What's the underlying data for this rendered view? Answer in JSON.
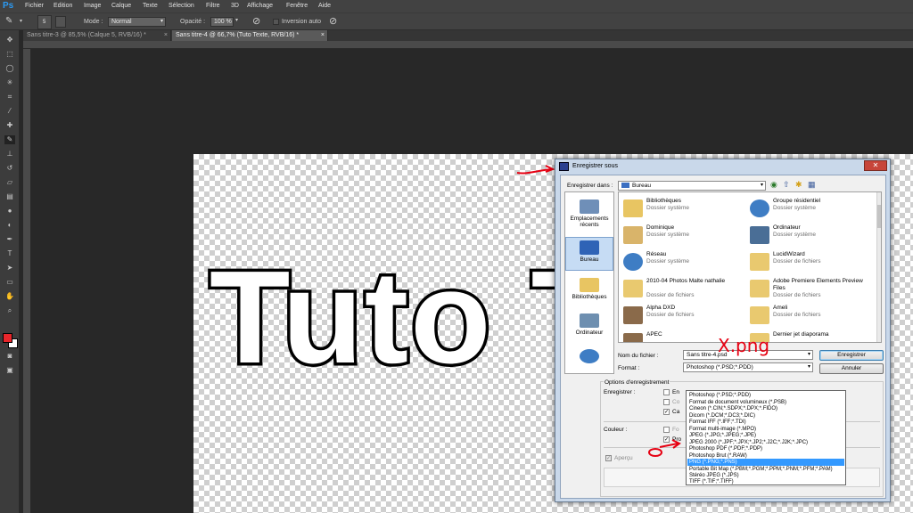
{
  "app": {
    "logo": "Ps"
  },
  "menu": [
    "Fichier",
    "Edition",
    "Image",
    "Calque",
    "Texte",
    "Sélection",
    "Filtre",
    "3D",
    "Affichage",
    "Fenêtre",
    "Aide"
  ],
  "options": {
    "brush_size": "5",
    "mode_label": "Mode :",
    "mode_value": "Normal",
    "opacity_label": "Opacité :",
    "opacity_value": "100 %",
    "auto_label": "Inversion auto"
  },
  "tabs": [
    {
      "label": "Sans titre-3 @ 85,5% (Calque 5, RVB/16) *",
      "close": "×"
    },
    {
      "label": "Sans titre-4 @ 66,7% (Tuto Texte, RVB/16) *",
      "close": "×"
    }
  ],
  "canvas": {
    "text": "Tuto T"
  },
  "colors": {
    "foreground": "#e8262b",
    "background": "#ffffff",
    "annotation": "#e60012",
    "selection": "#3399ff"
  },
  "dialog": {
    "title": "Enregistrer sous",
    "close": "✕",
    "save_in_label": "Enregistrer dans :",
    "save_in_value": "Bureau",
    "places": [
      "Emplacements récents",
      "Bureau",
      "Bibliothèques",
      "Ordinateur"
    ],
    "files": [
      {
        "name": "Bibliothèques",
        "sub": "Dossier système"
      },
      {
        "name": "Groupe résidentiel",
        "sub": "Dossier système"
      },
      {
        "name": "Dominique",
        "sub": "Dossier système"
      },
      {
        "name": "Ordinateur",
        "sub": "Dossier système"
      },
      {
        "name": "Réseau",
        "sub": "Dossier système"
      },
      {
        "name": "LucidWizard",
        "sub": "Dossier de fichiers"
      },
      {
        "name": "2010-04 Photos Malte nathalie",
        "sub": "Dossier de fichiers"
      },
      {
        "name": "Adobe Premiere Elements Preview Files",
        "sub": "Dossier de fichiers"
      },
      {
        "name": "Alpha DXD",
        "sub": "Dossier de fichiers"
      },
      {
        "name": "Ameli",
        "sub": "Dossier de fichiers"
      },
      {
        "name": "APEC",
        "sub": ""
      },
      {
        "name": "Dernier jet diaporama",
        "sub": ""
      }
    ],
    "filename_label": "Nom du fichier :",
    "filename_value": "Sans titre-4.psd",
    "format_label": "Format :",
    "format_value": "Photoshop (*.PSD;*.PDD)",
    "save_button": "Enregistrer",
    "cancel_button": "Annuler",
    "options_title": "Options d'enregistrement",
    "save_group_label": "Enregistrer :",
    "save_opts": [
      "En",
      "Co",
      "Ca"
    ],
    "color_label": "Couleur :",
    "color_opts": [
      "Fo",
      "Pro"
    ],
    "preview_label": "Aperçu",
    "formats": [
      "Photoshop (*.PSD;*.PDD)",
      "Format de document volumineux (*.PSB)",
      "Cineon (*.CIN;*.SDPX;*.DPX;*.FIDO)",
      "Dicom (*.DCM;*.DC3;*.DIC)",
      "Format IFF (*.IFF;*.TDI)",
      "Format multi-image (*.MPO)",
      "JPEG (*.JPG;*.JPEG;*.JPE)",
      "JPEG 2000 (*.JPF;*.JPX;*.JP2;*.J2C;*.J2K;*.JPC)",
      "Photoshop PDF (*.PDF;*.PDP)",
      "Photoshop Brut (*.RAW)",
      "PNG (*.PNG;*.PNS)",
      "Portable Bit Map (*.PBM;*.PGM;*.PPM;*.PNM;*.PFM;*.PAM)",
      "Stéréo JPEG (*.JPS)",
      "TIFF (*.TIF;*.TIFF)"
    ],
    "selected_format_index": 10,
    "annotation_text": "X.png"
  }
}
